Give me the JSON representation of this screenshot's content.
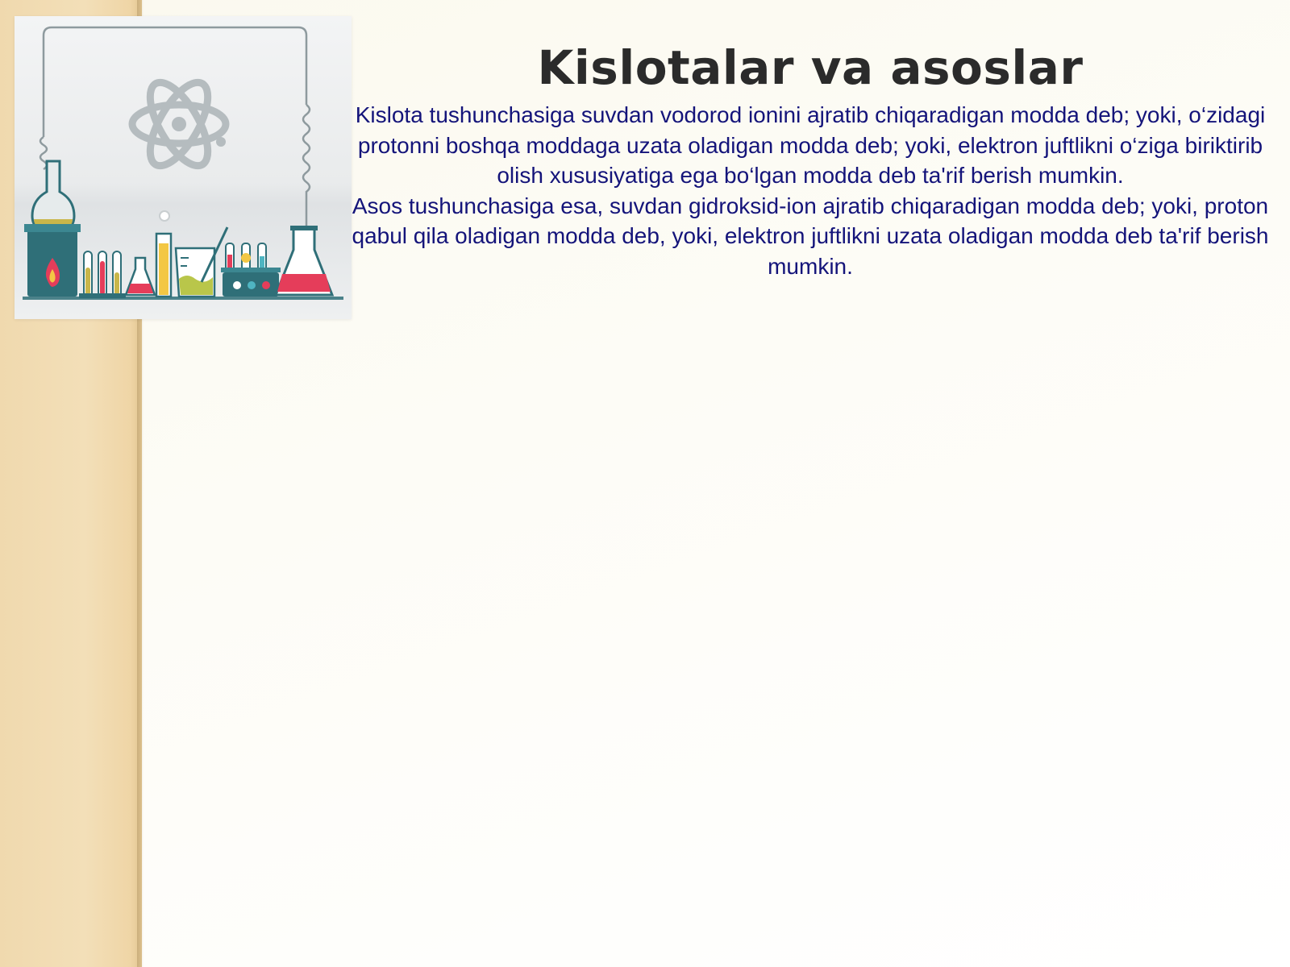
{
  "slide": {
    "title": "Kislotalar va asoslar",
    "paragraphs": [
      "Kislota tushunchasiga suvdan vodorod ionini ajratib chiqaradigan modda deb; yoki, o‘zidagi protonni boshqa moddaga uzata oladigan modda deb; yoki, elektron juftlikni o‘ziga biriktirib olish xususiyatiga ega bo‘lgan modda deb ta'rif berish mumkin.",
      "Asos tushunchasiga esa, suvdan gidroksid-ion ajratib chiqaradigan modda deb; yoki, proton qabul qila oladigan modda deb, yoki, elektron juftlikni uzata oladigan modda deb ta'rif berish mumkin."
    ],
    "colors": {
      "title": "#2b2b2b",
      "body": "#14147a",
      "side_strip": "#f0d9ae",
      "background": "#fdfcf7"
    },
    "illustration": {
      "icons": [
        "atom-icon",
        "round-flask-icon",
        "burner-icon",
        "test-tubes-icon",
        "beaker-icon",
        "erlenmeyer-flask-icon",
        "test-tube-rack-icon"
      ]
    }
  }
}
